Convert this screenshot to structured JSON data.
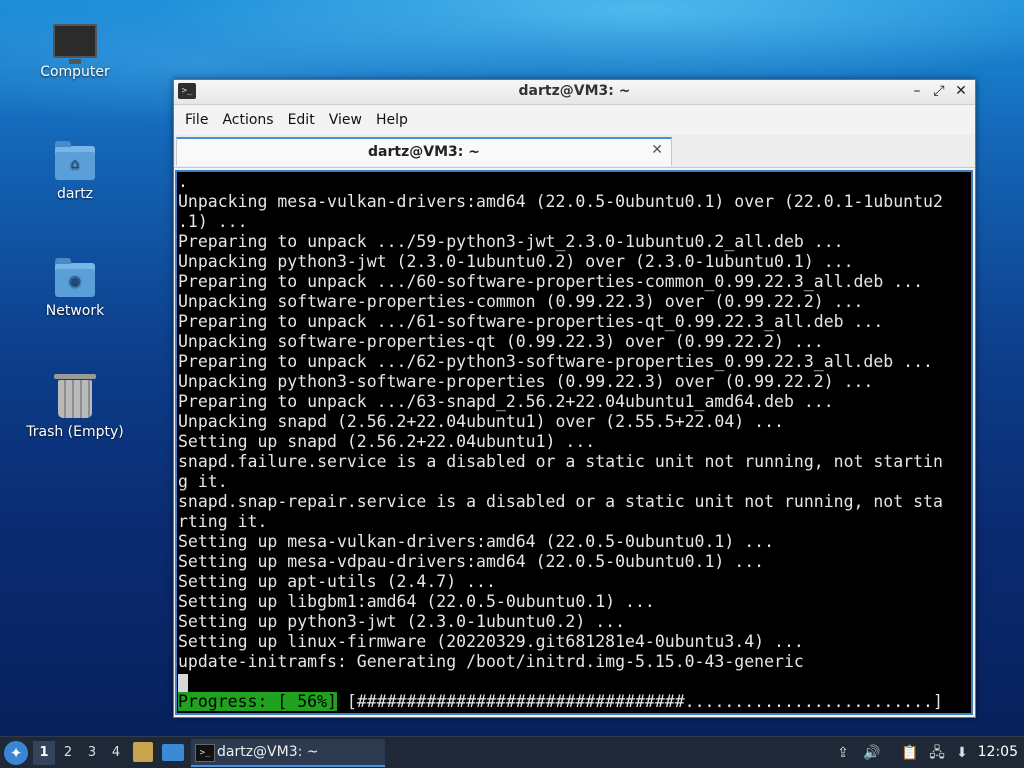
{
  "desktop": {
    "icons": [
      {
        "label": "Computer",
        "icon": "computer-icon"
      },
      {
        "label": "dartz",
        "icon": "home-folder-icon"
      },
      {
        "label": "Network",
        "icon": "network-folder-icon"
      },
      {
        "label": "Trash (Empty)",
        "icon": "trash-icon"
      }
    ]
  },
  "window": {
    "title": "dartz@VM3: ~",
    "controls": {
      "minimize": "–",
      "maximize": "⤢",
      "close": "✕"
    },
    "menu": [
      "File",
      "Actions",
      "Edit",
      "View",
      "Help"
    ],
    "tab": {
      "label": "dartz@VM3: ~",
      "close": "✕"
    }
  },
  "terminal": {
    "lines": [
      ".",
      "Unpacking mesa-vulkan-drivers:amd64 (22.0.5-0ubuntu0.1) over (22.0.1-1ubuntu2",
      ".1) ...",
      "Preparing to unpack .../59-python3-jwt_2.3.0-1ubuntu0.2_all.deb ...",
      "Unpacking python3-jwt (2.3.0-1ubuntu0.2) over (2.3.0-1ubuntu0.1) ...",
      "Preparing to unpack .../60-software-properties-common_0.99.22.3_all.deb ...",
      "Unpacking software-properties-common (0.99.22.3) over (0.99.22.2) ...",
      "Preparing to unpack .../61-software-properties-qt_0.99.22.3_all.deb ...",
      "Unpacking software-properties-qt (0.99.22.3) over (0.99.22.2) ...",
      "Preparing to unpack .../62-python3-software-properties_0.99.22.3_all.deb ...",
      "Unpacking python3-software-properties (0.99.22.3) over (0.99.22.2) ...",
      "Preparing to unpack .../63-snapd_2.56.2+22.04ubuntu1_amd64.deb ...",
      "Unpacking snapd (2.56.2+22.04ubuntu1) over (2.55.5+22.04) ...",
      "Setting up snapd (2.56.2+22.04ubuntu1) ...",
      "snapd.failure.service is a disabled or a static unit not running, not startin",
      "g it.",
      "snapd.snap-repair.service is a disabled or a static unit not running, not sta",
      "rting it.",
      "Setting up mesa-vulkan-drivers:amd64 (22.0.5-0ubuntu0.1) ...",
      "Setting up mesa-vdpau-drivers:amd64 (22.0.5-0ubuntu0.1) ...",
      "Setting up apt-utils (2.4.7) ...",
      "Setting up libgbm1:amd64 (22.0.5-0ubuntu0.1) ...",
      "Setting up python3-jwt (2.3.0-1ubuntu0.2) ...",
      "Setting up linux-firmware (20220329.git681281e4-0ubuntu3.4) ...",
      "update-initramfs: Generating /boot/initrd.img-5.15.0-43-generic"
    ],
    "progress": {
      "label": "Progress: [ 56%]",
      "bar": "[#################################.........................]",
      "percent": 56
    }
  },
  "taskbar": {
    "workspaces": [
      "1",
      "2",
      "3",
      "4"
    ],
    "active_workspace": "1",
    "task_label": "dartz@VM3: ~",
    "tray_icons": [
      "upload-icon",
      "volume-icon",
      "clipboard-icon",
      "network-icon",
      "updates-icon"
    ],
    "clock": "12:05"
  },
  "colors": {
    "accent": "#3c7fc4",
    "progress": "#1fa31f",
    "terminal_bg": "#000000"
  }
}
